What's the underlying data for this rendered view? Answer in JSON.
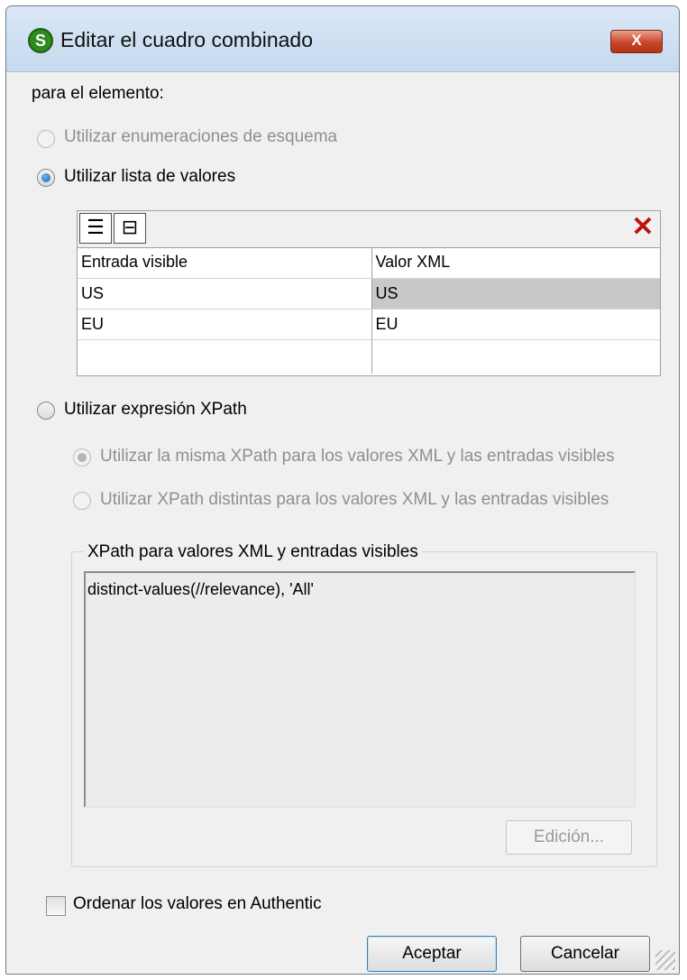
{
  "window": {
    "title": "Editar el cuadro combinado",
    "app_icon_glyph": "S",
    "close_glyph": "X"
  },
  "element_label": "para el elemento:",
  "options": {
    "schema_enum": {
      "label": "Utilizar enumeraciones de esquema",
      "selected": false,
      "enabled": false
    },
    "value_list": {
      "label": "Utilizar lista de valores",
      "selected": true,
      "enabled": true
    },
    "xpath": {
      "label": "Utilizar expresión XPath",
      "selected": false,
      "enabled": true
    },
    "same_xpath": {
      "label": "Utilizar la misma XPath para los valores XML y las entradas visibles",
      "selected": true,
      "enabled": false
    },
    "distinct_xpath": {
      "label": "Utilizar XPath distintas para los valores XML y las entradas visibles",
      "selected": false,
      "enabled": false
    }
  },
  "grid": {
    "toolbar_icons": [
      "append-row-icon",
      "insert-row-icon",
      "delete-row-icon"
    ],
    "columns": [
      "Entrada visible",
      "Valor XML"
    ],
    "rows": [
      {
        "visible": "US",
        "xml": "US",
        "selected_cell": "xml"
      },
      {
        "visible": "EU",
        "xml": "EU"
      }
    ]
  },
  "xpath_group": {
    "label": "XPath para valores XML y entradas visibles",
    "expression": "distinct-values(//relevance), 'All'",
    "edit_button": "Edición..."
  },
  "sort_checkbox": {
    "label": "Ordenar los valores en Authentic",
    "checked": false
  },
  "buttons": {
    "ok": "Aceptar",
    "cancel": "Cancelar"
  },
  "colors": {
    "title_bar": "#c6d9ee",
    "close_button": "#c9452b",
    "selected_cell": "#c8c8c8",
    "delete_icon": "#c01010"
  }
}
